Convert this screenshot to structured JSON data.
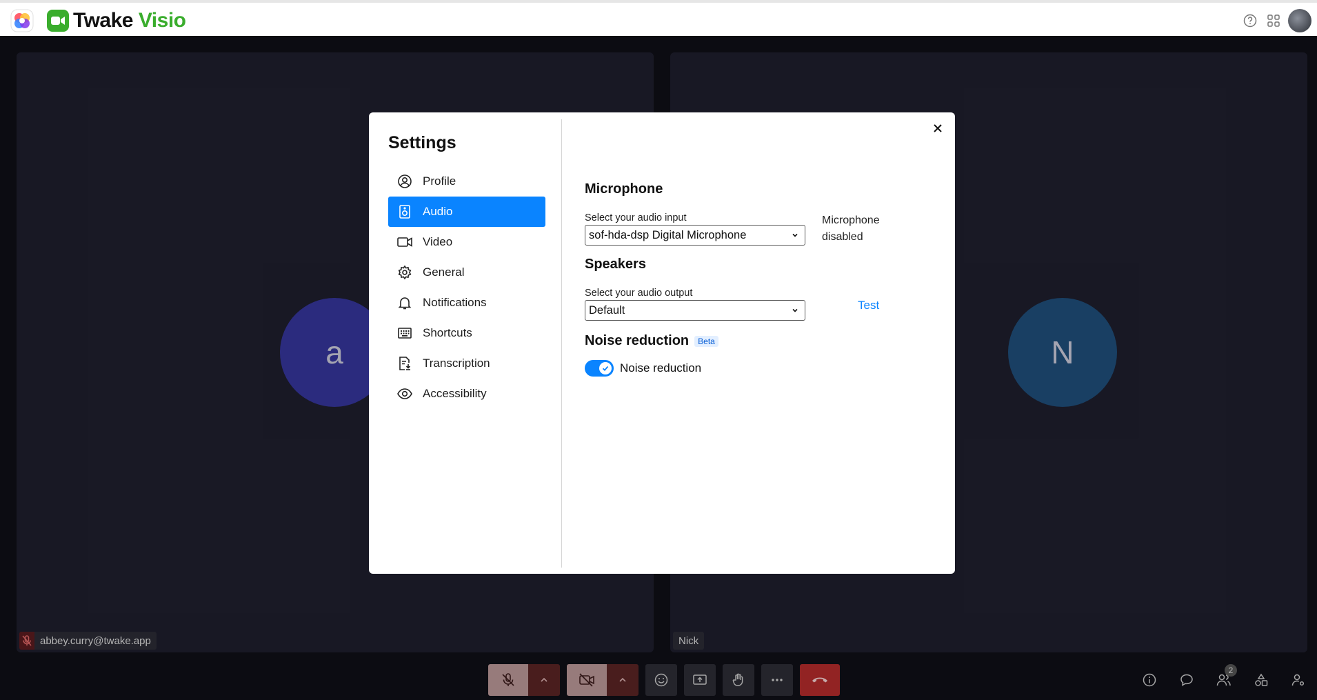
{
  "header": {
    "app_name_primary": "Twake",
    "app_name_secondary": "Visio",
    "icons": [
      "app-switcher-icon",
      "help-icon",
      "apps-grid-icon",
      "user-avatar"
    ]
  },
  "participants": {
    "left": {
      "initial": "a",
      "name": "abbey.curry@twake.app",
      "muted": true
    },
    "right": {
      "initial": "N",
      "name": "Nick"
    }
  },
  "settings": {
    "title": "Settings",
    "nav": [
      {
        "label": "Profile",
        "icon": "profile-icon"
      },
      {
        "label": "Audio",
        "icon": "audio-icon",
        "active": true
      },
      {
        "label": "Video",
        "icon": "video-icon"
      },
      {
        "label": "General",
        "icon": "gear-icon"
      },
      {
        "label": "Notifications",
        "icon": "bell-icon"
      },
      {
        "label": "Shortcuts",
        "icon": "keyboard-icon"
      },
      {
        "label": "Transcription",
        "icon": "transcription-icon"
      },
      {
        "label": "Accessibility",
        "icon": "eye-icon"
      }
    ],
    "microphone": {
      "heading": "Microphone",
      "label": "Select your audio input",
      "value": "sof-hda-dsp Digital Microphone",
      "status": "Microphone disabled"
    },
    "speakers": {
      "heading": "Speakers",
      "label": "Select your audio output",
      "value": "Default",
      "test_label": "Test"
    },
    "noise": {
      "heading": "Noise reduction",
      "badge": "Beta",
      "toggle_label": "Noise reduction",
      "enabled": true
    }
  },
  "toolbar": {
    "participants_count": "2"
  },
  "colors": {
    "accent": "#0a84ff",
    "brand": "#3aad2d",
    "leave": "#b32b2b"
  }
}
